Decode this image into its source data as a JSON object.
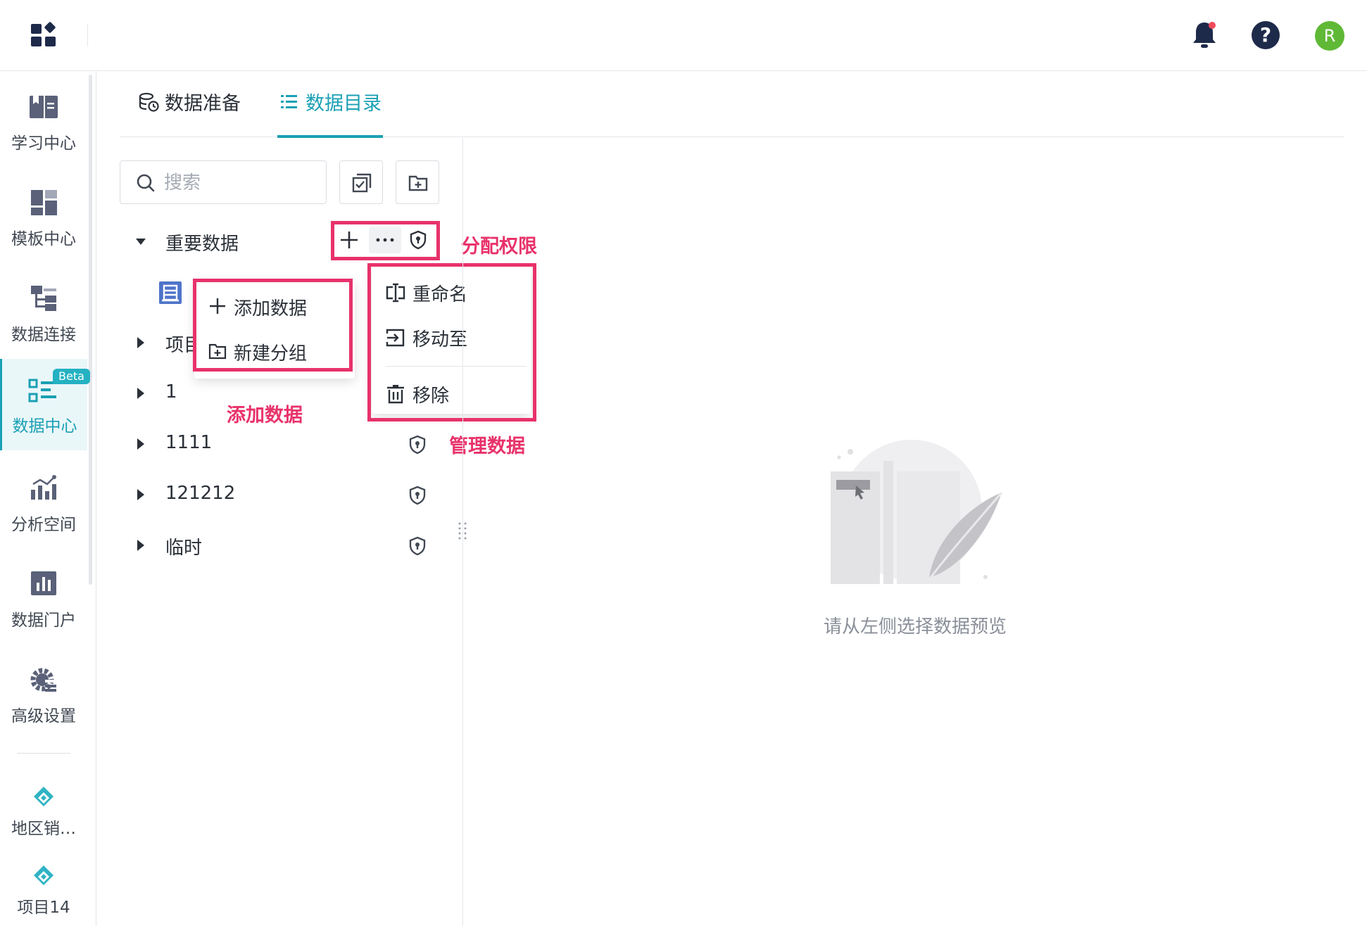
{
  "topbar": {
    "avatar_letter": "R",
    "help_glyph": "?"
  },
  "sidebar": {
    "items": [
      {
        "label": "学习中心",
        "icon": "book-icon"
      },
      {
        "label": "模板中心",
        "icon": "template-icon"
      },
      {
        "label": "数据连接",
        "icon": "connection-icon"
      },
      {
        "label": "数据中心",
        "icon": "data-center-icon",
        "badge": "Beta",
        "active": true
      },
      {
        "label": "分析空间",
        "icon": "analysis-icon"
      },
      {
        "label": "数据门户",
        "icon": "portal-icon"
      },
      {
        "label": "高级设置",
        "icon": "gear-icon"
      }
    ],
    "projects": [
      {
        "label": "地区销…"
      },
      {
        "label": "项目14"
      }
    ]
  },
  "tabs": [
    {
      "label": "数据准备"
    },
    {
      "label": "数据目录",
      "active": true
    }
  ],
  "search": {
    "placeholder": "搜索",
    "value": ""
  },
  "tree": [
    {
      "label": "重要数据",
      "expanded": true
    },
    {
      "label": "项目"
    },
    {
      "label": "1"
    },
    {
      "label": "1111"
    },
    {
      "label": "121212"
    },
    {
      "label": "临时"
    }
  ],
  "add_menu": {
    "items": [
      {
        "label": "添加数据"
      },
      {
        "label": "新建分组"
      }
    ]
  },
  "more_menu": {
    "items": [
      {
        "label": "重命名"
      },
      {
        "label": "移动至"
      },
      {
        "label": "移除"
      }
    ]
  },
  "annotations": {
    "assign_permission": "分配权限",
    "add_data": "添加数据",
    "manage_data": "管理数据"
  },
  "empty_state": {
    "text": "请从左侧选择数据预览"
  },
  "colors": {
    "accent": "#1ba0b4",
    "highlight": "#e8326b",
    "nav_dark": "#1e2a4a",
    "avatar": "#5fb936"
  }
}
